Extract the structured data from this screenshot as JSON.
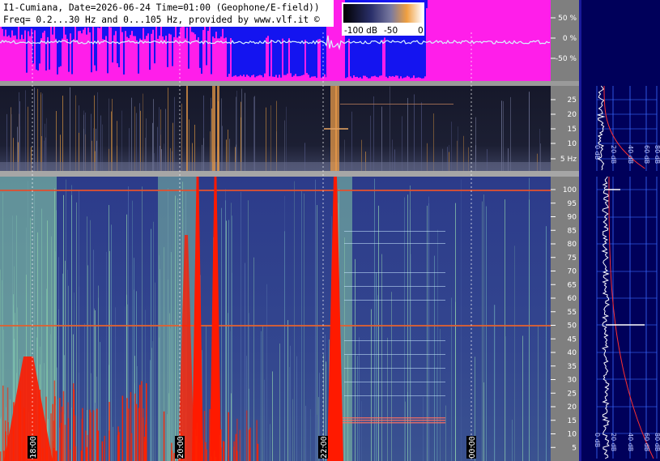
{
  "header": {
    "line1": "I1-Cumiana, Date=2026-06-24 Time=01:00 (Geophone/E-field))",
    "line2": "Freq= 0.2...30 Hz and 0...105 Hz, provided by www.vlf.it ©"
  },
  "colorbar": {
    "ticks": [
      "-100 dB",
      "-50",
      "0"
    ]
  },
  "chart_data": [
    {
      "type": "area",
      "name": "amplitude-panel",
      "y_ticks": [
        "50 %",
        "0 %",
        "-50 %"
      ],
      "colors": {
        "background": "#1414f0",
        "fill": "#ff1eea",
        "trace": "#d8f4ff"
      }
    },
    {
      "type": "heatmap",
      "name": "low-frequency-spectrogram",
      "y_ticks": [
        "25",
        "20",
        "15",
        "10",
        "5 Hz"
      ],
      "ylim": [
        0.2,
        30
      ],
      "colors": {
        "low": "#0a0c1e",
        "mid": "#3a4a8a",
        "high": "#f0a040"
      }
    },
    {
      "type": "heatmap",
      "name": "high-frequency-spectrogram",
      "y_ticks": [
        "100",
        "95",
        "90",
        "85",
        "80",
        "75",
        "70",
        "65",
        "60",
        "55",
        "50",
        "45",
        "40",
        "35",
        "30",
        "25",
        "20",
        "15",
        "10",
        "5"
      ],
      "ylim": [
        0,
        105
      ],
      "x_time_labels": [
        "18:00",
        "20:00",
        "22:00",
        "00:00"
      ],
      "colors": {
        "low": "#2a3a8c",
        "mid": "#88d8a8",
        "high": "#ff1a00"
      }
    },
    {
      "type": "line",
      "name": "low-frequency-average-spectrum",
      "x_ticks": [
        "0 dB",
        "20 dB",
        "40 dB",
        "60 dB",
        "80 dB"
      ]
    },
    {
      "type": "line",
      "name": "high-frequency-average-spectrum",
      "x_ticks": [
        "0 dB",
        "20 dB",
        "40 dB",
        "60 dB",
        "80 dB"
      ]
    }
  ]
}
